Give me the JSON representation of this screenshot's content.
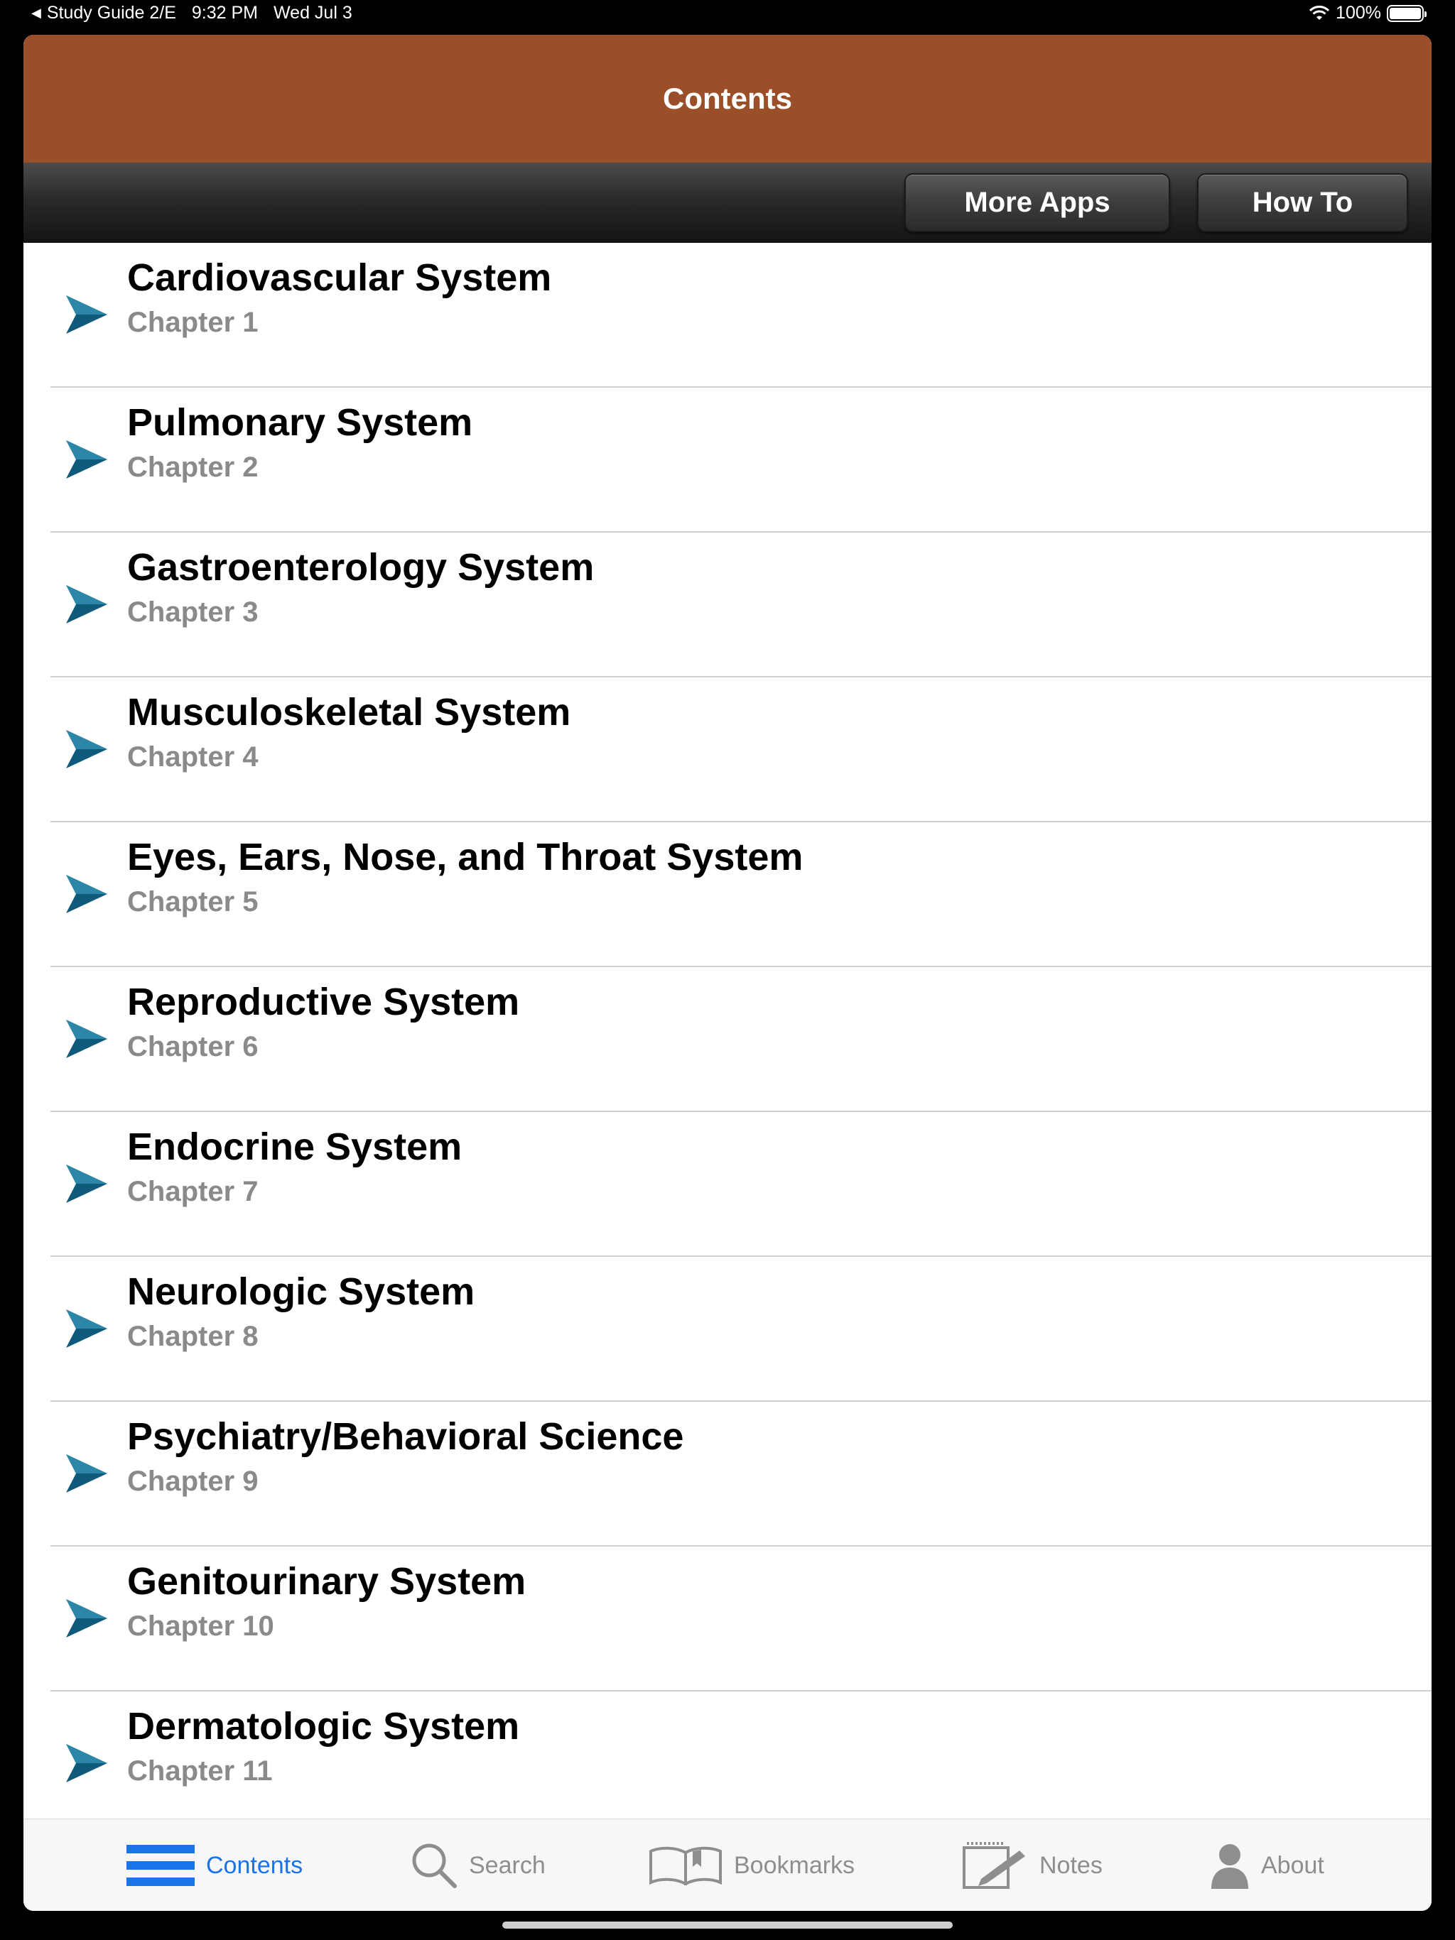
{
  "status_bar": {
    "back_app": "Study Guide 2/E",
    "time": "9:32 PM",
    "date": "Wed Jul 3",
    "battery": "100%"
  },
  "nav": {
    "title": "Contents"
  },
  "toolbar": {
    "more_apps": "More Apps",
    "how_to": "How To"
  },
  "chapters": [
    {
      "title": "Cardiovascular System",
      "subtitle": "Chapter 1"
    },
    {
      "title": "Pulmonary System",
      "subtitle": "Chapter 2"
    },
    {
      "title": "Gastroenterology System",
      "subtitle": "Chapter 3"
    },
    {
      "title": "Musculoskeletal System",
      "subtitle": "Chapter 4"
    },
    {
      "title": "Eyes, Ears, Nose, and Throat System",
      "subtitle": "Chapter 5"
    },
    {
      "title": "Reproductive System",
      "subtitle": "Chapter 6"
    },
    {
      "title": "Endocrine System",
      "subtitle": "Chapter 7"
    },
    {
      "title": "Neurologic System",
      "subtitle": "Chapter 8"
    },
    {
      "title": "Psychiatry/Behavioral Science",
      "subtitle": "Chapter 9"
    },
    {
      "title": "Genitourinary System",
      "subtitle": "Chapter 10"
    },
    {
      "title": "Dermatologic System",
      "subtitle": "Chapter 11"
    }
  ],
  "tabs": {
    "contents": "Contents",
    "search": "Search",
    "bookmarks": "Bookmarks",
    "notes": "Notes",
    "about": "About"
  },
  "colors": {
    "nav_bar": "#9a4f28",
    "active_tab": "#1a73e8",
    "chevron": "#0f5a7a"
  }
}
